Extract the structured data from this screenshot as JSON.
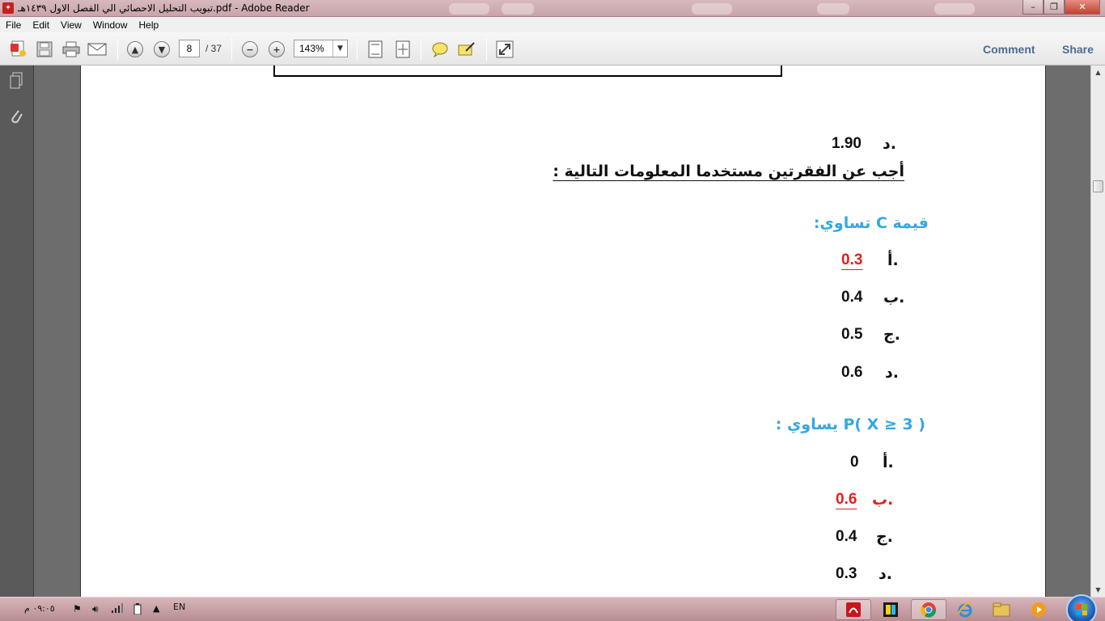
{
  "window": {
    "title": "تبويب التحليل الاحصائي الي الفصل الاول ١٤٣٩هـ.pdf - Adobe Reader",
    "app_icon": "adobe-pdf-icon"
  },
  "menu": [
    "File",
    "Edit",
    "View",
    "Window",
    "Help"
  ],
  "toolbar": {
    "page_current": "8",
    "page_total": "/ 37",
    "zoom": "143%",
    "comment": "Comment",
    "share": "Share"
  },
  "document": {
    "prev_answer": {
      "letter": "د.",
      "value": "1.90"
    },
    "heading": "أجب عن الفقرتين مستخدما المعلومات التالية :",
    "questions": [
      {
        "prompt": "قيمة  C  تساوي:",
        "options": [
          {
            "letter": "أ.",
            "value": "0.3",
            "correct": true
          },
          {
            "letter": "ب.",
            "value": "0.4",
            "correct": false
          },
          {
            "letter": "ج.",
            "value": "0.5",
            "correct": false
          },
          {
            "letter": "د.",
            "value": "0.6",
            "correct": false
          }
        ]
      },
      {
        "prompt": "P( X ≥ 3 )  يساوي :",
        "options": [
          {
            "letter": "أ.",
            "value": "0",
            "correct": false
          },
          {
            "letter": "ب.",
            "value": "0.6",
            "correct": true
          },
          {
            "letter": "ج.",
            "value": "0.4",
            "correct": false
          },
          {
            "letter": "د.",
            "value": "0.3",
            "correct": false
          }
        ]
      }
    ]
  },
  "taskbar": {
    "clock": "٠٩:٠٥ م",
    "language": "EN"
  },
  "colors": {
    "question_blue": "#33a9df",
    "correct_red": "#e0211e",
    "link_blue": "#4c6b94"
  }
}
